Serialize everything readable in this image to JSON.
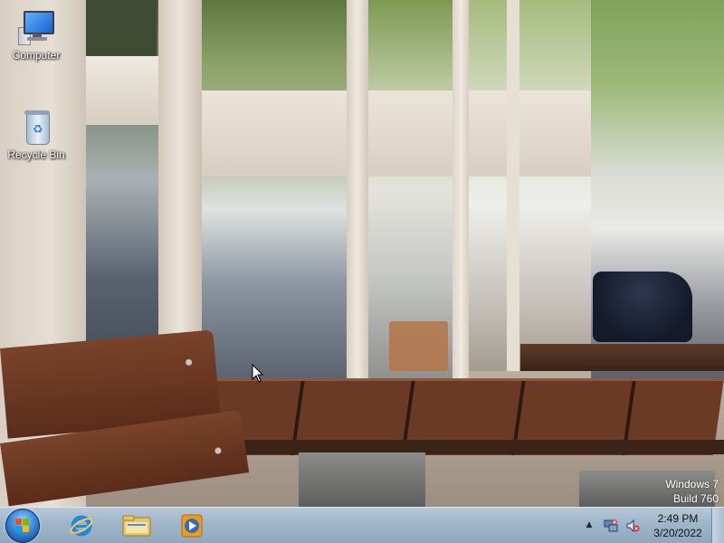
{
  "desktop": {
    "icons": [
      {
        "label": "Computer",
        "icon": "computer-icon"
      },
      {
        "label": "Recycle Bin",
        "icon": "recycle-bin-icon"
      }
    ],
    "watermark": {
      "line1": "Windows 7",
      "line2": "Build 760"
    }
  },
  "taskbar": {
    "start_button": "start-orb-icon",
    "pinned": [
      {
        "name": "Internet Explorer",
        "icon": "internet-explorer-icon"
      },
      {
        "name": "Windows Explorer",
        "icon": "folder-explorer-icon"
      },
      {
        "name": "Windows Media Player",
        "icon": "media-player-icon"
      }
    ],
    "tray": {
      "icons": [
        "show-hidden-icons-arrow",
        "network-icon",
        "volume-muted-icon"
      ],
      "time": "2:49 PM",
      "date": "3/20/2022"
    }
  },
  "colors": {
    "taskbar": "#9fb5c9",
    "icon_label_text": "#ffffff",
    "clock_text": "#111111"
  }
}
